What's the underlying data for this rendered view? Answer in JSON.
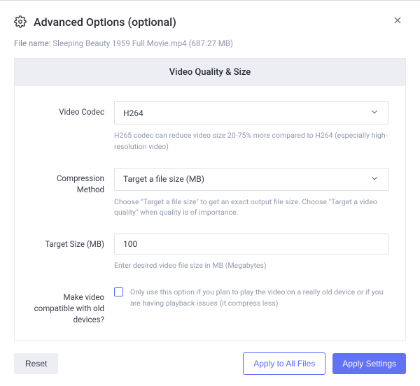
{
  "header": {
    "title": "Advanced Options (optional)"
  },
  "file": {
    "label": "File name:",
    "value": "Sleeping Beauty 1959 Full Movie.mp4 (687.27 MB)"
  },
  "panel": {
    "title": "Video Quality & Size",
    "codec": {
      "label": "Video Codec",
      "value": "H264",
      "help": "H265 codec can reduce video size 20-75% more compared to H264 (especially high-resolution video)"
    },
    "method": {
      "label": "Compression Method",
      "value": "Target a file size (MB)",
      "help": "Choose \"Target a file size\" to get an exact output file size. Choose \"Target a video quality\" when quality is of importance."
    },
    "target": {
      "label": "Target Size (MB)",
      "value": "100",
      "help": "Enter desired video file size in MB (Megabytes)"
    },
    "compat": {
      "label": "Make video compatible with old devices?",
      "help": "Only use this option if you plan to play the video on a really old device or if you are having playback issues (it compress less)"
    }
  },
  "footer": {
    "reset": "Reset",
    "apply_all": "Apply to All Files",
    "apply": "Apply Settings"
  }
}
